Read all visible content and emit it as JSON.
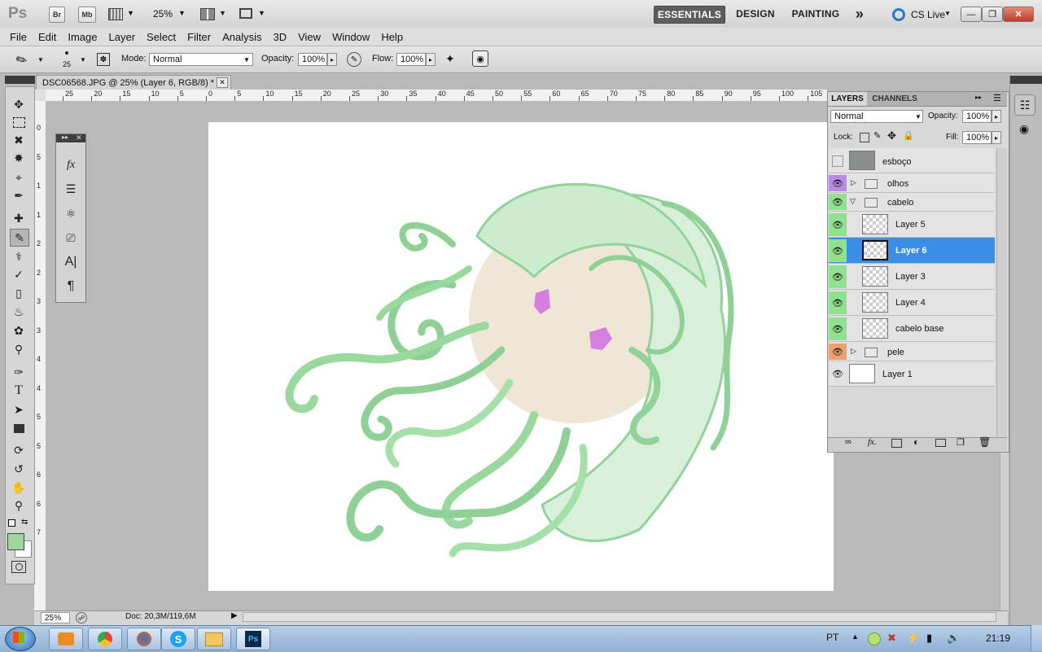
{
  "titlebar": {
    "app_logo": "Ps",
    "bridge_btn": "Br",
    "minibridge_btn": "Mb",
    "zoom_value": "25%",
    "workspaces": [
      "ESSENTIALS",
      "DESIGN",
      "PAINTING"
    ],
    "more_workspaces": "»",
    "cs_live": "CS Live"
  },
  "menu": [
    "File",
    "Edit",
    "Image",
    "Layer",
    "Select",
    "Filter",
    "Analysis",
    "3D",
    "View",
    "Window",
    "Help"
  ],
  "options": {
    "brush_size": "25",
    "mode_label": "Mode:",
    "mode_value": "Normal",
    "opacity_label": "Opacity:",
    "opacity_value": "100%",
    "flow_label": "Flow:",
    "flow_value": "100%"
  },
  "document": {
    "tab_title": "DSC06568.JPG @ 25% (Layer 6, RGB/8) *"
  },
  "rulers": {
    "h_labels": [
      "25",
      "20",
      "15",
      "10",
      "5",
      "0",
      "5",
      "10",
      "15",
      "20",
      "25",
      "30",
      "35",
      "40",
      "45",
      "50",
      "55",
      "60",
      "65",
      "70",
      "75",
      "80",
      "85",
      "90",
      "95",
      "100",
      "105"
    ],
    "v_labels": [
      "0",
      "5",
      "1",
      "1",
      "2",
      "2",
      "3",
      "3",
      "4",
      "4",
      "5",
      "5",
      "6",
      "6",
      "7"
    ]
  },
  "layers_panel": {
    "tabs": [
      "LAYERS",
      "CHANNELS"
    ],
    "blend_mode": "Normal",
    "opacity_label": "Opacity:",
    "opacity_value": "100%",
    "lock_label": "Lock:",
    "fill_label": "Fill:",
    "fill_value": "100%",
    "layers": [
      {
        "name": "esboço",
        "visible": false,
        "kind": "image",
        "eye_color": "#e3e3e3"
      },
      {
        "name": "olhos",
        "visible": true,
        "kind": "group-collapsed",
        "eye_color": "#b98be6"
      },
      {
        "name": "cabelo",
        "visible": true,
        "kind": "group-expanded",
        "eye_color": "#8fe08f"
      },
      {
        "name": "Layer 5",
        "visible": true,
        "kind": "layer",
        "eye_color": "#8fe08f"
      },
      {
        "name": "Layer 6",
        "visible": true,
        "kind": "layer",
        "selected": true,
        "eye_color": "#8fe08f"
      },
      {
        "name": "Layer 3",
        "visible": true,
        "kind": "layer",
        "eye_color": "#8fe08f"
      },
      {
        "name": "Layer 4",
        "visible": true,
        "kind": "layer",
        "eye_color": "#8fe08f"
      },
      {
        "name": "cabelo base",
        "visible": true,
        "kind": "layer",
        "eye_color": "#8fe08f"
      },
      {
        "name": "pele",
        "visible": true,
        "kind": "group-collapsed",
        "eye_color": "#f0a070"
      },
      {
        "name": "Layer 1",
        "visible": true,
        "kind": "image",
        "eye_color": "#e3e3e3"
      }
    ]
  },
  "statusbar": {
    "zoom": "25%",
    "doc_info": "Doc: 20,3M/119,6M"
  },
  "colors": {
    "foreground": "#9fd6a0",
    "background": "#ffffff",
    "selection": "#3a8ee6",
    "hair": "#9ad99e",
    "skin": "#efe6d6",
    "eyes": "#d57fe0"
  },
  "taskbar": {
    "lang": "PT",
    "time": "21:19"
  }
}
